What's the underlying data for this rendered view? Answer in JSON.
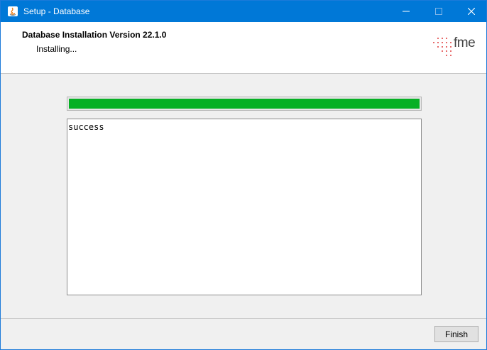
{
  "window": {
    "title": "Setup - Database"
  },
  "header": {
    "title": "Database Installation Version 22.1.0",
    "status": "Installing...",
    "logo_text": "fme"
  },
  "progress": {
    "value_percent": 100,
    "fill_color": "#06b025"
  },
  "log": {
    "text": "success"
  },
  "footer": {
    "finish_label": "Finish"
  },
  "colors": {
    "titlebar": "#0078d7",
    "logo_dots": "#e03c3c"
  }
}
